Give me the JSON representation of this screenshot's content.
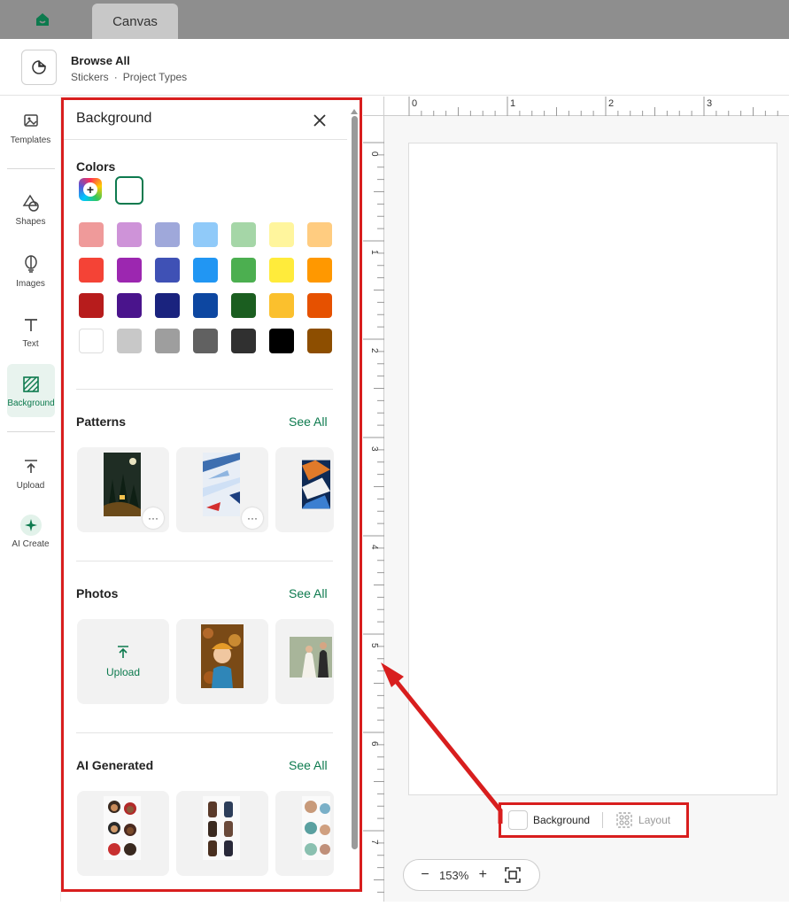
{
  "tabs": {
    "home_icon": "home-icon",
    "active_tab": "Canvas"
  },
  "header": {
    "title": "Browse All",
    "crumb_1": "Stickers",
    "crumb_sep": "·",
    "crumb_2": "Project Types"
  },
  "rail": {
    "items": [
      {
        "label": "Templates",
        "icon": "templates-icon"
      },
      {
        "label": "Shapes",
        "icon": "shapes-icon"
      },
      {
        "label": "Images",
        "icon": "images-icon"
      },
      {
        "label": "Text",
        "icon": "text-icon"
      },
      {
        "label": "Background",
        "icon": "background-icon",
        "active": true
      },
      {
        "label": "Upload",
        "icon": "upload-icon"
      },
      {
        "label": "AI Create",
        "icon": "ai-create-icon"
      }
    ]
  },
  "panel": {
    "title": "Background",
    "colors": {
      "title": "Colors",
      "add_symbol": "+",
      "swatches": [
        [
          "#ef9a9a",
          "#ce93d8",
          "#9fa8da",
          "#90caf9",
          "#a5d6a7",
          "#fff59d",
          "#ffcc80"
        ],
        [
          "#f44336",
          "#9c27b0",
          "#3f51b5",
          "#2196f3",
          "#4caf50",
          "#ffeb3b",
          "#ff9800"
        ],
        [
          "#b71c1c",
          "#4a148c",
          "#1a237e",
          "#0d47a1",
          "#1b5e20",
          "#fbc02d",
          "#e65100"
        ],
        [
          "#ffffff",
          "#c8c8c8",
          "#9e9e9e",
          "#616161",
          "#303030",
          "#000000",
          "#8d4e00"
        ]
      ]
    },
    "patterns": {
      "title": "Patterns",
      "see_all": "See All",
      "more_label": "···"
    },
    "photos": {
      "title": "Photos",
      "see_all": "See All",
      "upload_label": "Upload"
    },
    "ai": {
      "title": "AI Generated",
      "see_all": "See All"
    }
  },
  "ruler": {
    "top_labels": [
      "0",
      "1",
      "2",
      "3"
    ],
    "left_labels": [
      "0",
      "1",
      "2",
      "3",
      "4",
      "5",
      "6",
      "7"
    ]
  },
  "canvas_footer": {
    "background_label": "Background",
    "layout_label": "Layout"
  },
  "zoom": {
    "minus": "−",
    "value": "153%",
    "plus": "+"
  },
  "accent_color": "#0d7a4e",
  "highlight_color": "#d81e1e"
}
